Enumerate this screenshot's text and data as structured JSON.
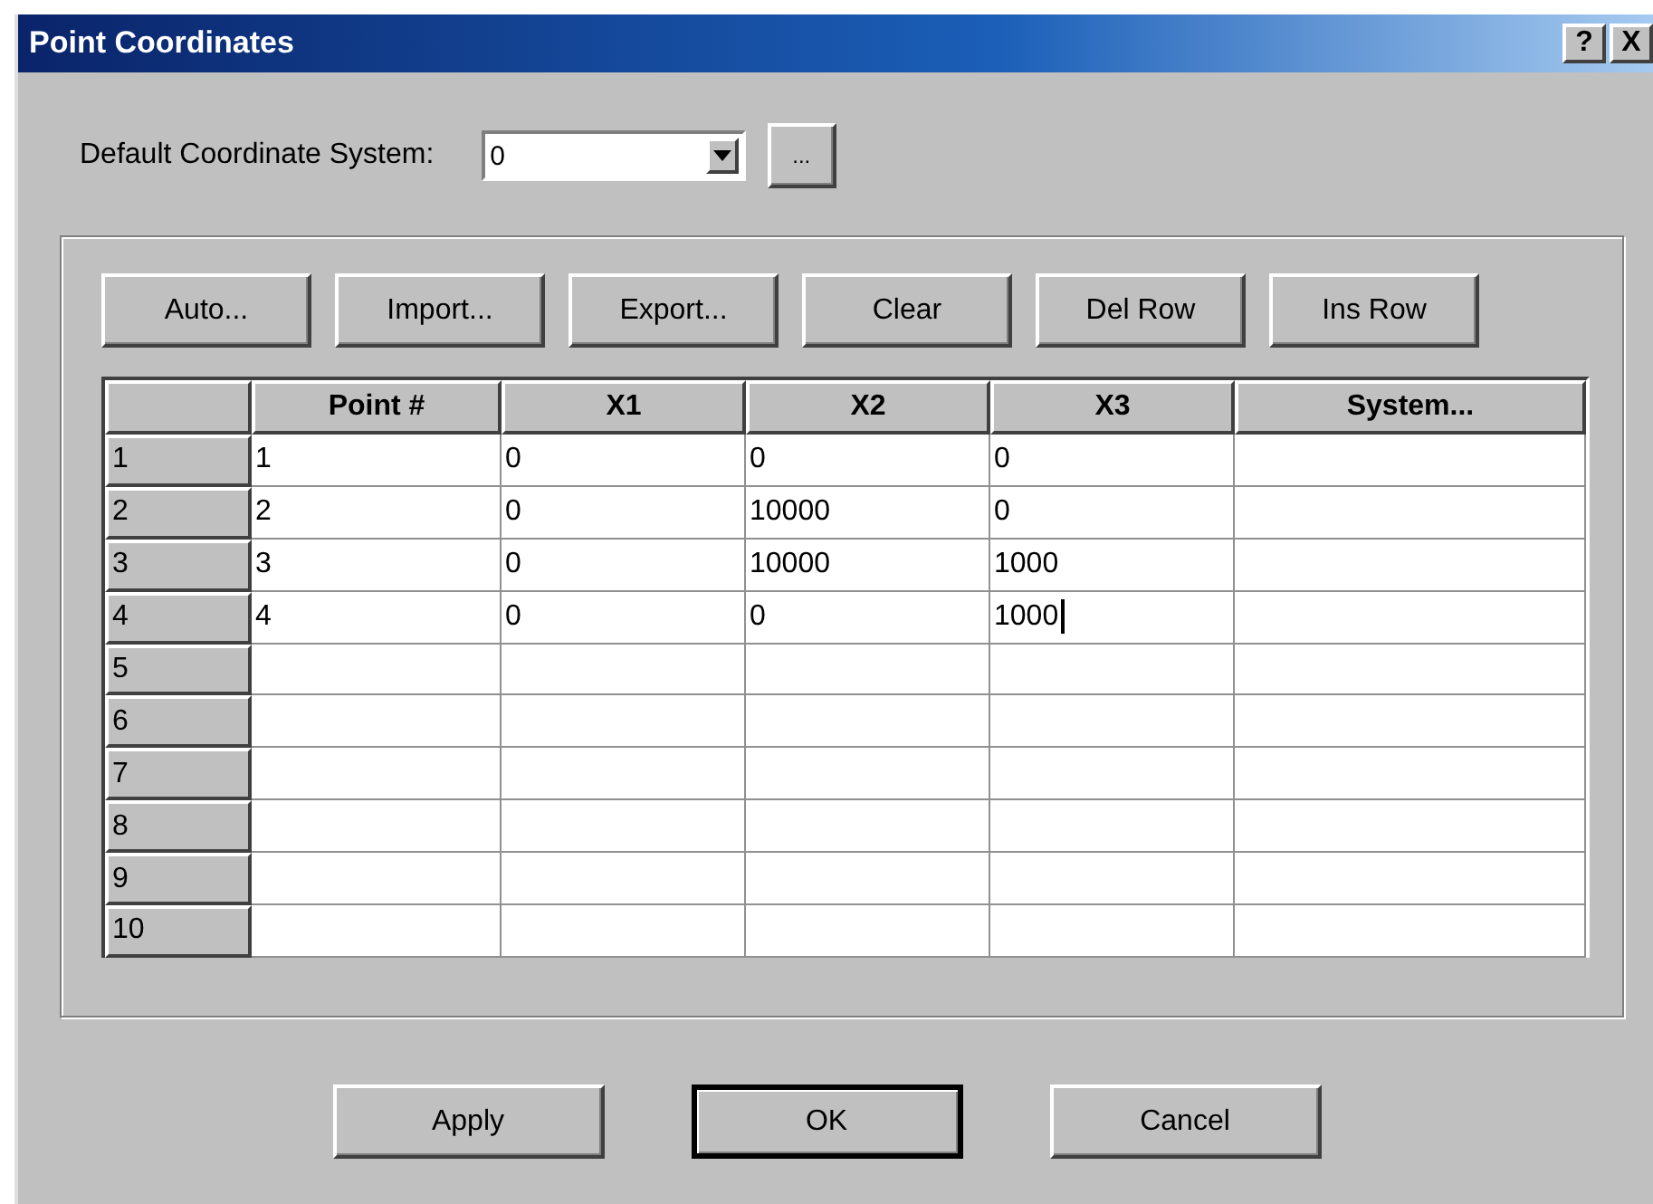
{
  "window": {
    "title": "Point Coordinates",
    "title_buttons": [
      {
        "kind": "help",
        "label": "?"
      },
      {
        "kind": "close",
        "label": "X"
      }
    ]
  },
  "default_system": {
    "label": "Default Coordinate System:",
    "value": "0",
    "browse": "..."
  },
  "toolbar": [
    "Auto...",
    "Import...",
    "Export...",
    "Clear",
    "Del Row",
    "Ins Row"
  ],
  "table": {
    "columns": [
      "Point #",
      "X1",
      "X2",
      "X3",
      "System..."
    ],
    "rows": [
      {
        "header": "1",
        "cells": [
          "1",
          "0",
          "0",
          "0"
        ],
        "caret": false
      },
      {
        "header": "2",
        "cells": [
          "2",
          "0",
          "10000",
          "0"
        ],
        "caret": false
      },
      {
        "header": "3",
        "cells": [
          "3",
          "0",
          "10000",
          "1000"
        ],
        "caret": false
      },
      {
        "header": "4",
        "cells": [
          "4",
          "0",
          "0",
          "1000"
        ],
        "caret": true
      },
      {
        "header": "5",
        "cells": [],
        "caret": false
      },
      {
        "header": "6",
        "cells": [],
        "caret": false
      },
      {
        "header": "7",
        "cells": [],
        "caret": false
      },
      {
        "header": "8",
        "cells": [],
        "caret": false
      },
      {
        "header": "9",
        "cells": [],
        "caret": false
      },
      {
        "header": "10",
        "cells": [],
        "caret": false
      }
    ]
  },
  "buttons": [
    {
      "label": "Apply",
      "default": false
    },
    {
      "label": "OK",
      "default": true
    },
    {
      "label": "Cancel",
      "default": false
    }
  ]
}
